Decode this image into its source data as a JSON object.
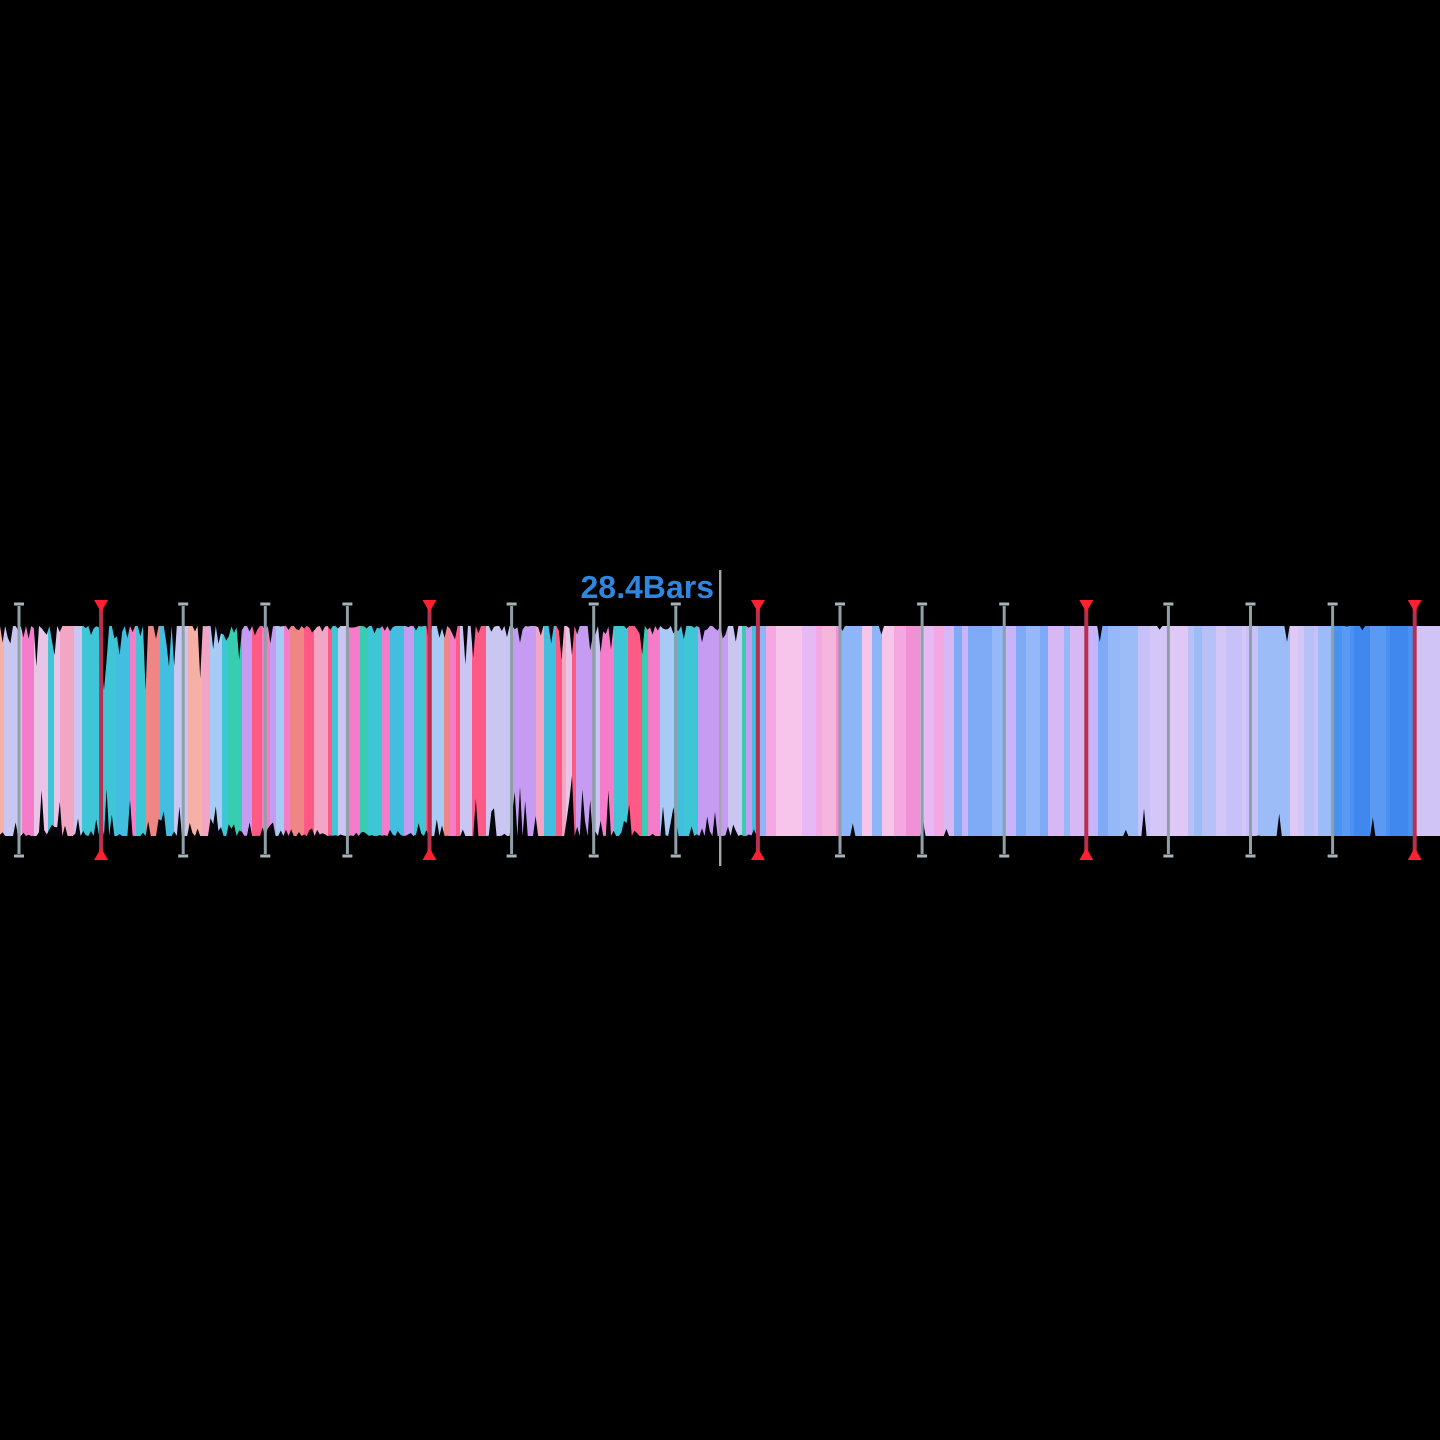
{
  "waveform": {
    "position_label": "28.4Bars",
    "beat_grid": [
      {
        "downbeat": false
      },
      {
        "downbeat": true
      },
      {
        "downbeat": false
      },
      {
        "downbeat": false
      },
      {
        "downbeat": false
      },
      {
        "downbeat": true
      },
      {
        "downbeat": false
      },
      {
        "downbeat": false
      },
      {
        "downbeat": false
      },
      {
        "downbeat": true
      },
      {
        "downbeat": false
      },
      {
        "downbeat": false
      },
      {
        "downbeat": false
      },
      {
        "downbeat": true
      },
      {
        "downbeat": false
      },
      {
        "downbeat": false
      },
      {
        "downbeat": false
      },
      {
        "downbeat": true
      }
    ]
  }
}
